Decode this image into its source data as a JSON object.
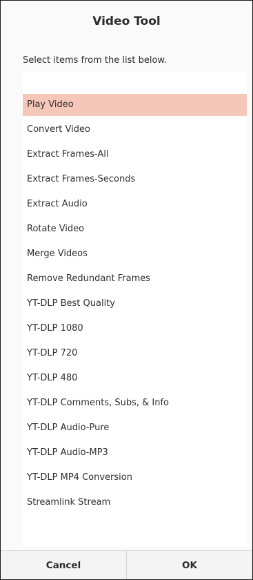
{
  "dialog": {
    "title": "Video Tool",
    "prompt": "Select items from the list below.",
    "selected_color": "#f4c7b9"
  },
  "list": {
    "items": [
      {
        "label": "Play Video",
        "selected": true
      },
      {
        "label": "Convert Video",
        "selected": false
      },
      {
        "label": "Extract Frames-All",
        "selected": false
      },
      {
        "label": "Extract Frames-Seconds",
        "selected": false
      },
      {
        "label": "Extract Audio",
        "selected": false
      },
      {
        "label": "Rotate Video",
        "selected": false
      },
      {
        "label": "Merge Videos",
        "selected": false
      },
      {
        "label": "Remove Redundant Frames",
        "selected": false
      },
      {
        "label": "YT-DLP Best Quality",
        "selected": false
      },
      {
        "label": "YT-DLP 1080",
        "selected": false
      },
      {
        "label": "YT-DLP 720",
        "selected": false
      },
      {
        "label": "YT-DLP 480",
        "selected": false
      },
      {
        "label": "YT-DLP Comments, Subs, & Info",
        "selected": false
      },
      {
        "label": "YT-DLP Audio-Pure",
        "selected": false
      },
      {
        "label": "YT-DLP Audio-MP3",
        "selected": false
      },
      {
        "label": "YT-DLP MP4 Conversion",
        "selected": false
      },
      {
        "label": "Streamlink Stream",
        "selected": false
      }
    ]
  },
  "buttons": {
    "cancel_label": "Cancel",
    "ok_label": "OK"
  }
}
